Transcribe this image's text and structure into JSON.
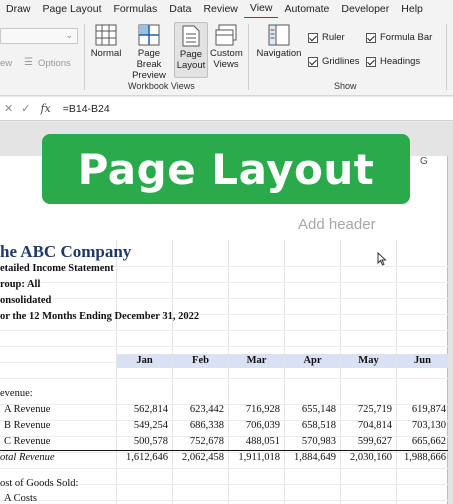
{
  "menu": [
    "Draw",
    "Page Layout",
    "Formulas",
    "Data",
    "Review",
    "View",
    "Automate",
    "Developer",
    "Help"
  ],
  "menu_active": "View",
  "ribbon": {
    "partial_left": [
      "ew",
      "Options"
    ],
    "workbook_views": {
      "buttons": [
        "Normal",
        "Page Break Preview",
        "Page Layout",
        "Custom Views"
      ],
      "label": "Workbook Views"
    },
    "show": {
      "navigation": "Navigation",
      "checks": [
        "Ruler",
        "Formula Bar",
        "Gridlines",
        "Headings"
      ],
      "label": "Show"
    }
  },
  "formula_bar": {
    "fx": "fx",
    "formula": "=B14-B24"
  },
  "column_header": "G",
  "banner": "Page Layout",
  "add_header": "Add header",
  "report": {
    "company": "he ABC Company",
    "lines": [
      "etailed Income Statement",
      "roup: All",
      "onsolidated",
      "or the 12 Months Ending December 31, 2022"
    ],
    "months": [
      "Jan",
      "Feb",
      "Mar",
      "Apr",
      "May",
      "Jun"
    ],
    "rows": [
      {
        "label": "evenue:",
        "values": []
      },
      {
        "label": "A Revenue",
        "values": [
          "562,814",
          "623,442",
          "716,928",
          "655,148",
          "725,719",
          "619,874"
        ]
      },
      {
        "label": "B Revenue",
        "values": [
          "549,254",
          "686,338",
          "706,039",
          "658,518",
          "704,814",
          "703,130"
        ]
      },
      {
        "label": "C Revenue",
        "values": [
          "500,578",
          "752,678",
          "488,051",
          "570,983",
          "599,627",
          "665,662"
        ]
      },
      {
        "label": "otal Revenue",
        "values": [
          "1,612,646",
          "2,062,458",
          "1,911,018",
          "1,884,649",
          "2,030,160",
          "1,988,666"
        ]
      },
      {
        "label": "ost of Goods Sold:",
        "values": []
      },
      {
        "label": "A Costs",
        "values": []
      }
    ]
  }
}
